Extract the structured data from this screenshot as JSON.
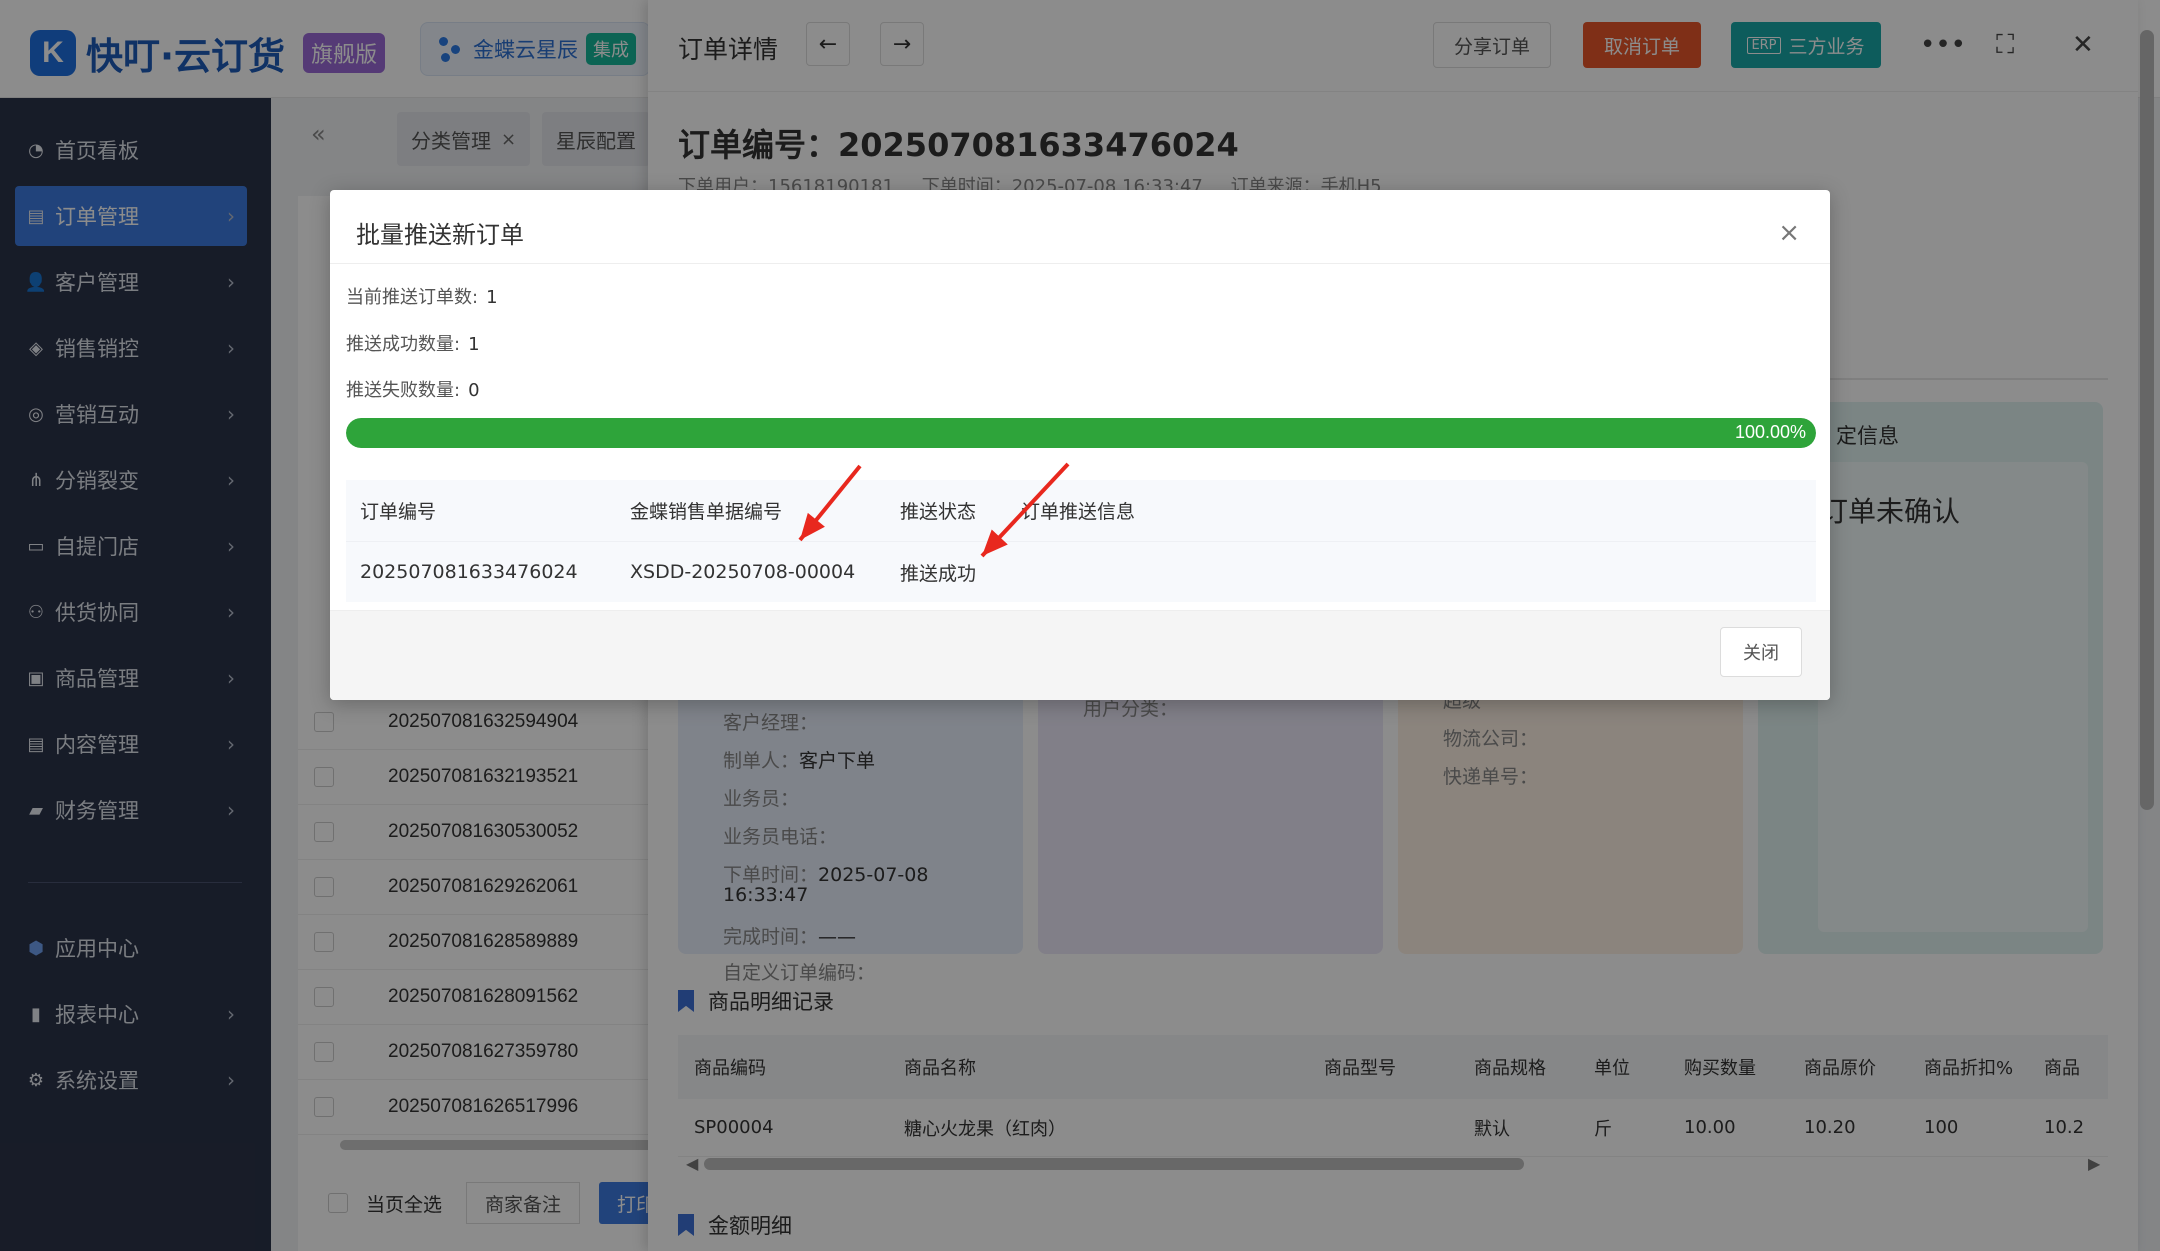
{
  "app": {
    "logo_letter": "K",
    "name": "快叮·云订货",
    "edition": "旗舰版",
    "integration_chip": "金蝶云星辰",
    "integration_tag": "集成"
  },
  "sidebar": {
    "items": [
      {
        "label": "首页看板",
        "icon": "dashboard-icon"
      },
      {
        "label": "订单管理",
        "icon": "order-icon"
      },
      {
        "label": "客户管理",
        "icon": "customer-icon"
      },
      {
        "label": "销售销控",
        "icon": "tag-icon"
      },
      {
        "label": "营销互动",
        "icon": "marketing-icon"
      },
      {
        "label": "分销裂变",
        "icon": "distribution-icon"
      },
      {
        "label": "自提门店",
        "icon": "store-icon"
      },
      {
        "label": "供货协同",
        "icon": "supply-icon"
      },
      {
        "label": "商品管理",
        "icon": "goods-icon"
      },
      {
        "label": "内容管理",
        "icon": "content-icon"
      },
      {
        "label": "财务管理",
        "icon": "wallet-icon"
      },
      {
        "label": "应用中心",
        "icon": "app-center-icon"
      },
      {
        "label": "报表中心",
        "icon": "report-icon"
      },
      {
        "label": "系统设置",
        "icon": "settings-icon"
      }
    ]
  },
  "tabs": {
    "items": [
      {
        "label": "分类管理",
        "close": "×"
      },
      {
        "label": "星辰配置"
      }
    ]
  },
  "order_list": {
    "rows": [
      "202507081632594904",
      "202507081632193521",
      "202507081630530052",
      "202507081629262061",
      "202507081628589889",
      "202507081628091562",
      "202507081627359780",
      "202507081626517996"
    ],
    "select_all_label": "当页全选",
    "merchant_note_button": "商家备注",
    "print_button": "打印"
  },
  "drawer": {
    "title": "订单详情",
    "share_button": "分享订单",
    "cancel_button": "取消订单",
    "erp_mark": "ERP",
    "erp_button": "三方业务",
    "order_number_title": "订单编号：202507081633476024",
    "meta": {
      "user": "下单用户：15618190181",
      "time": "下单时间：2025-07-08 16:33:47",
      "source": "订单来源：手机H5"
    },
    "info_card": {
      "manager": "客户经理：",
      "creator_label": "制单人：",
      "creator_value": "客户下单",
      "salesman": "业务员：",
      "salesman_phone": "业务员电话：",
      "order_time_label": "下单时间：",
      "order_time_value": "2025-07-08",
      "order_time_value2": "16:33:47",
      "complete_time_label": "完成时间：",
      "complete_time_value": "——",
      "custom_code": "自定义订单编码："
    },
    "user_card": {
      "category": "用户分类："
    },
    "logistics_card": {
      "partial": "超级",
      "company": "物流公司：",
      "tracking": "快递单号："
    },
    "status_card": {
      "title": "定信息",
      "status": "订单未确认"
    },
    "goods_section_title": "商品明细记录",
    "goods_table": {
      "headers": [
        "商品编码",
        "商品名称",
        "商品型号",
        "商品规格",
        "单位",
        "购买数量",
        "商品原价",
        "商品折扣%",
        "商品"
      ],
      "rows": [
        [
          "SP00004",
          "糖心火龙果（红肉）",
          "",
          "默认",
          "斤",
          "10.00",
          "10.20",
          "100",
          "10.2"
        ]
      ]
    },
    "amount_section_title": "金额明细"
  },
  "modal": {
    "title": "批量推送新订单",
    "close_icon": "×",
    "stats": {
      "current_label": "当前推送订单数:",
      "current_value": "1",
      "success_label": "推送成功数量:",
      "success_value": "1",
      "fail_label": "推送失败数量:",
      "fail_value": "0"
    },
    "progress": {
      "percent": 100,
      "label": "100.00%"
    },
    "table": {
      "headers": [
        "订单编号",
        "金蝶销售单据编号",
        "推送状态",
        "订单推送信息"
      ],
      "rows": [
        [
          "202507081633476024",
          "XSDD-20250708-00004",
          "推送成功",
          ""
        ]
      ]
    },
    "close_button": "关闭"
  },
  "colors": {
    "sidebar_bg": "#2b3349",
    "primary": "#3d7be0",
    "cancel": "#e8572a",
    "erp": "#18a8a8",
    "progress": "#2ea43a",
    "annotation_arrow": "#e8281e"
  }
}
